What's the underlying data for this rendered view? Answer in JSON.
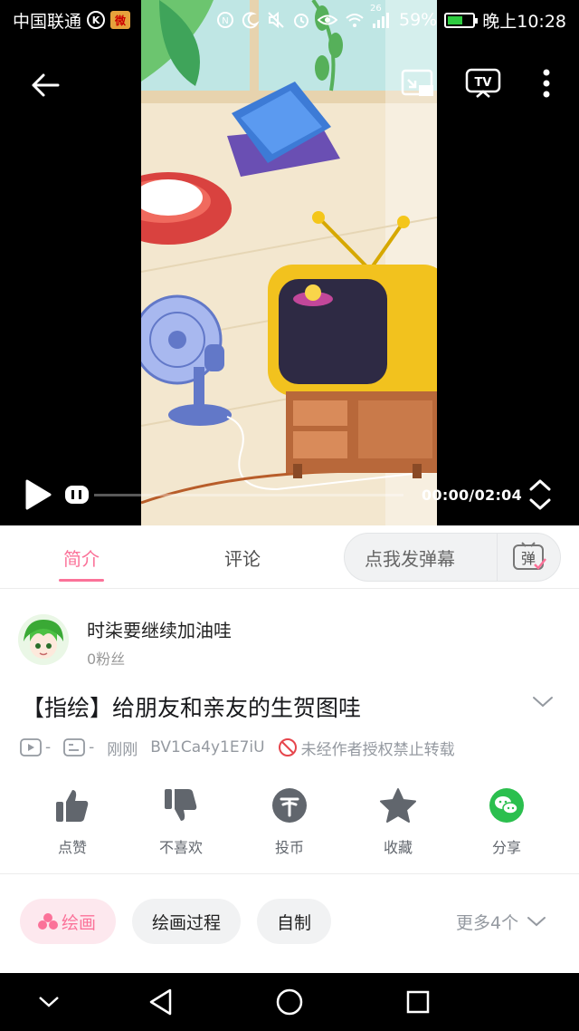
{
  "status_bar": {
    "carrier": "中国联通",
    "battery": "59%",
    "battery_level": 0.59,
    "network": "26",
    "time": "晚上10:28"
  },
  "player": {
    "time": "00:00/02:04",
    "progress": 0.0,
    "tv_label": "TV"
  },
  "tabs": {
    "intro": "简介",
    "comments": "评论",
    "danmaku_placeholder": "点我发弹幕",
    "danmaku_icon_label": "弹"
  },
  "uploader": {
    "name": "时柒要继续加油哇",
    "fans": "0粉丝"
  },
  "video": {
    "title": "【指绘】给朋友和亲友的生贺图哇",
    "views": "-",
    "danmaku_count": "-",
    "posted": "刚刚",
    "bvid": "BV1Ca4y1E7iU",
    "copyright_notice": "未经作者授权禁止转载"
  },
  "actions": {
    "like": "点赞",
    "dislike": "不喜欢",
    "coin": "投币",
    "favorite": "收藏",
    "share": "分享"
  },
  "tags": {
    "items": [
      "绘画",
      "绘画过程",
      "自制"
    ],
    "more": "更多4个"
  },
  "colors": {
    "accent": "#fb7299",
    "wechat": "#2bbf4e"
  }
}
